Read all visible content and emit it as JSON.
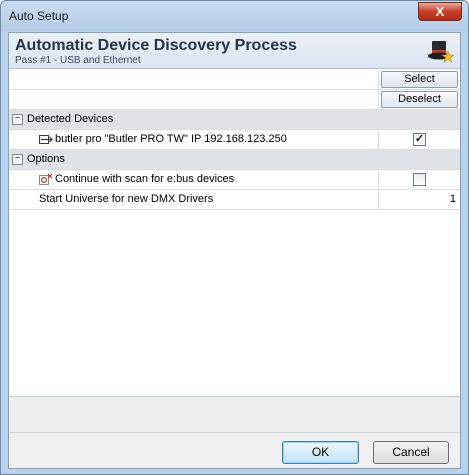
{
  "window": {
    "title": "Auto Setup",
    "close_label": "X"
  },
  "header": {
    "title": "Automatic Device Discovery Process",
    "subtitle": "Pass #1 - USB and Ethernet",
    "icon": "magic-hat-icon"
  },
  "actions": {
    "select_label": "Select",
    "deselect_label": "Deselect"
  },
  "categories": [
    {
      "label": "Detected Devices",
      "expander": "−",
      "rows": [
        {
          "label": "butler pro \"Butler PRO TW\" IP 192.168.123.250",
          "icon": "device-icon",
          "checked": true,
          "check_glyph": "✓"
        }
      ]
    },
    {
      "label": "Options",
      "expander": "−",
      "rows": [
        {
          "label": "Continue with scan for e:bus devices",
          "icon": "scan-icon",
          "checked": false,
          "check_glyph": ""
        },
        {
          "label": "Start Universe for new DMX Drivers",
          "value": "1"
        }
      ]
    }
  ],
  "footer": {
    "ok_label": "OK",
    "cancel_label": "Cancel"
  }
}
